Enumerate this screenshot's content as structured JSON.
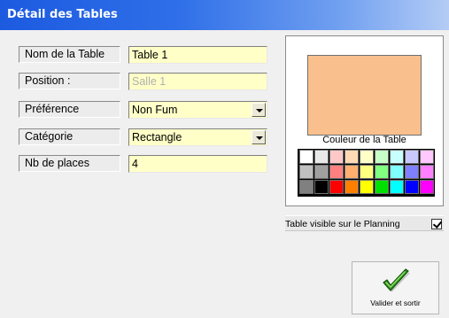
{
  "window": {
    "title": "Détail des Tables"
  },
  "form": {
    "name": {
      "label": "Nom de la Table",
      "value": "Table 1"
    },
    "position": {
      "label": "Position :",
      "value": "Salle 1"
    },
    "preference": {
      "label": "Préférence",
      "value": "Non Fum"
    },
    "category": {
      "label": "Catégorie",
      "value": "Rectangle"
    },
    "places": {
      "label": "Nb de places",
      "value": "4"
    }
  },
  "color": {
    "label": "Couleur de la Table",
    "selected": "#f9c08d",
    "palette": [
      "#ffffff",
      "#e8e8e8",
      "#ffc8c8",
      "#ffd8b4",
      "#ffffc8",
      "#c8ffc8",
      "#c8ffff",
      "#c8c8ff",
      "#ffc8ff",
      "#c0c0c0",
      "#a0a0a0",
      "#ff8080",
      "#ffb070",
      "#ffff80",
      "#80ff80",
      "#80ffff",
      "#8080ff",
      "#ff80ff",
      "#808080",
      "#000000",
      "#ff0000",
      "#ff8000",
      "#ffff00",
      "#00e000",
      "#00ffff",
      "#0000ff",
      "#ff00ff"
    ]
  },
  "visibility": {
    "label": "Table visible sur le Planning",
    "checked": true
  },
  "actions": {
    "validate_label": "Valider et sortir"
  }
}
